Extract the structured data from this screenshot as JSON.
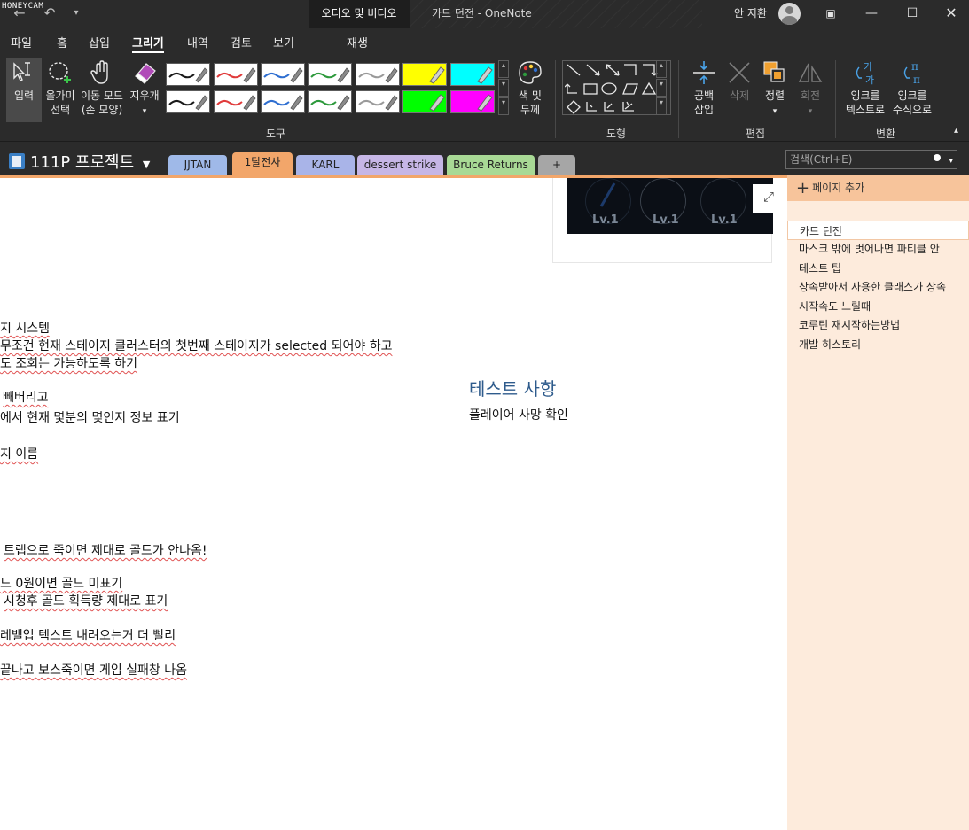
{
  "watermark": "HONEYCAM",
  "titlebar": {
    "context_tab": "오디오 및 비디오",
    "doc_title": "카드 던전  -  OneNote",
    "user_name": "안 지환",
    "icons": [
      "back-arrow-icon",
      "undo-icon",
      "customize-qat-icon",
      "avatar",
      "ribbon-display-icon",
      "minimize-icon",
      "maximize-icon",
      "close-icon"
    ]
  },
  "ribbon_tabs": [
    "파일",
    "홈",
    "삽입",
    "그리기",
    "내역",
    "검토",
    "보기",
    "재생"
  ],
  "ribbon": {
    "tools": {
      "type_label": "입력",
      "lasso_label1": "올가미",
      "lasso_label2": "선택",
      "pan_label1": "이동 모드",
      "pan_label2": "(손 모양)",
      "eraser_label": "지우개",
      "color_thickness1": "색 및",
      "color_thickness2": "두께",
      "group_label": "도구"
    },
    "shapes": {
      "group_label": "도형"
    },
    "edit": {
      "insert_space1": "공백",
      "insert_space2": "삽입",
      "delete": "삭제",
      "arrange": "정렬",
      "rotate": "회전",
      "group_label": "편집"
    },
    "convert": {
      "ink_to_text1": "잉크를",
      "ink_to_text2": "텍스트로",
      "ink_to_math1": "잉크를",
      "ink_to_math2": "수식으로",
      "group_label": "변환"
    },
    "pen_colors": [
      "#1a1a1a",
      "#e03b3b",
      "#2f6fd1",
      "#2e9a3d",
      "#9a9a9a",
      "#ffff00",
      "#00ffff",
      "#1a1a1a",
      "#e03b3b",
      "#2f6fd1",
      "#2e9a3d",
      "#9a9a9a",
      "#00ff00",
      "#ff00ff"
    ]
  },
  "notebook": {
    "name": "111P 프로젝트",
    "sections": [
      {
        "label": "JJTAN",
        "color": "#9fb9e8"
      },
      {
        "label": "1달전사",
        "color": "#f2a66a"
      },
      {
        "label": "KARL",
        "color": "#a9b4e8"
      },
      {
        "label": "dessert strike",
        "color": "#c6b6e6"
      },
      {
        "label": "Bruce Returns",
        "color": "#a8d995"
      },
      {
        "label": "+",
        "color": "#a6a6a6"
      }
    ],
    "search_placeholder": "검색(Ctrl+E)"
  },
  "page_content": {
    "image_labels": [
      "Lv.1",
      "Lv.1",
      "Lv.1"
    ],
    "lines": [
      "지 시스템",
      "무조건 현재 스테이지 클러스터의 첫번째 스테이지가 selected 되어야 하고",
      "도 조회는 가능하도록 하기",
      "빼버리고",
      "에서 현재 몇분의 몇인지 정보 표기",
      "지 이름",
      "트랩으로 죽이면 제대로 골드가 안나옴!",
      "드 0원이면 골드 미표기",
      "시청후 골드 획득량 제대로 표기",
      "레벨업 텍스트 내려오는거 더 빨리",
      "끝나고 보스죽이면 게임 실패창 나옴"
    ],
    "test_title": "테스트 사항",
    "test_body": "플레이어 사망 확인"
  },
  "pages_pane": {
    "add_page": "페이지 추가",
    "items": [
      "카드 던전",
      "마스크 밖에 벗어나면 파티클 안",
      "테스트 팁",
      "상속받아서 사용한 클래스가 상속",
      "시작속도 느릴때",
      "코루틴 재시작하는방법",
      "개발 히스토리"
    ],
    "active_index": 0
  }
}
